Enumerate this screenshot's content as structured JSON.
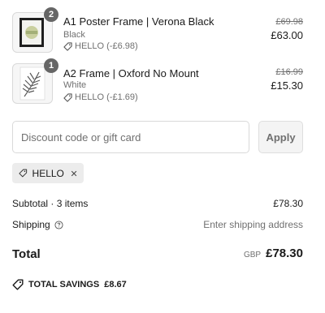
{
  "items": [
    {
      "title": "A1 Poster Frame | Verona Black",
      "variant": "Black",
      "discount": "HELLO (-£6.98)",
      "original_price": "£69.98",
      "price": "£63.00",
      "quantity": "2"
    },
    {
      "title": "A2 Frame | Oxford No Mount",
      "variant": "White",
      "discount": "HELLO (-£1.69)",
      "original_price": "£16.99",
      "price": "£15.30",
      "quantity": "1"
    }
  ],
  "discount_form": {
    "placeholder": "Discount code or gift card",
    "apply_label": "Apply"
  },
  "applied_code": {
    "label": "HELLO"
  },
  "summary": {
    "subtotal_label": "Subtotal · 3 items",
    "subtotal_value": "£78.30",
    "shipping_label": "Shipping",
    "shipping_value": "Enter shipping address",
    "total_label": "Total",
    "currency": "GBP",
    "total_value": "£78.30",
    "savings_label": "TOTAL SAVINGS",
    "savings_value": "£8.67"
  },
  "icons": {
    "discount_tag": "tag-icon",
    "remove_code": "close-icon",
    "shipping_help": "help-circle-icon",
    "savings": "tag-icon"
  },
  "colors": {
    "text": "#1a1a1a",
    "muted": "#707070",
    "badge": "#666666",
    "border": "#d9d9d9",
    "chip_bg": "#ececec"
  }
}
